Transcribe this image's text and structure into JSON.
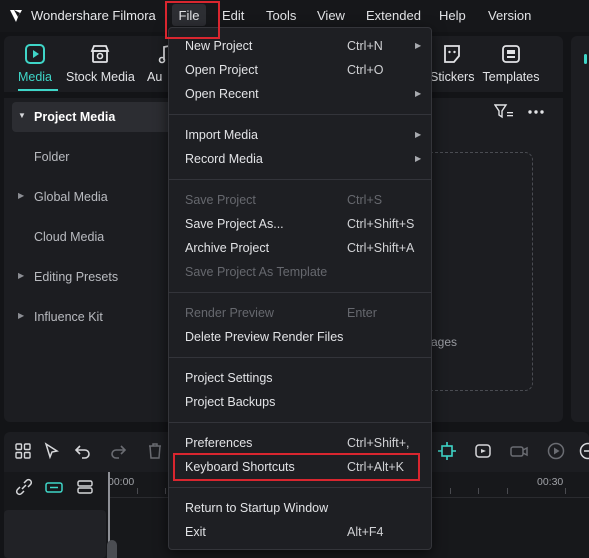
{
  "app": {
    "title": "Wondershare Filmora",
    "accent_color": "#3fd6c8",
    "highlight_color": "#d9262f"
  },
  "menubar": {
    "items": [
      "File",
      "Edit",
      "Tools",
      "View",
      "Extended",
      "Help",
      "Version"
    ],
    "active": "File"
  },
  "toolbar": {
    "tools": [
      {
        "label": "Media",
        "icon": "media-icon",
        "active": true
      },
      {
        "label": "Stock Media",
        "icon": "stock-media-icon"
      },
      {
        "label": "Au",
        "icon": "audio-icon"
      },
      {
        "label": "Stickers",
        "icon": "stickers-icon"
      },
      {
        "label": "Templates",
        "icon": "templates-icon"
      }
    ]
  },
  "sidebar": {
    "items": [
      {
        "label": "Project Media",
        "expandable": true,
        "active": true
      },
      {
        "label": "Folder",
        "expandable": false
      },
      {
        "label": "Global Media",
        "expandable": true
      },
      {
        "label": "Cloud Media",
        "expandable": false
      },
      {
        "label": "Editing Presets",
        "expandable": true
      },
      {
        "label": "Influence Kit",
        "expandable": true
      }
    ]
  },
  "media_area": {
    "dropzone_text": "ages"
  },
  "timeline": {
    "time_start": "00:00",
    "time_end": "00:30"
  },
  "file_menu": {
    "groups": [
      [
        {
          "label": "New Project",
          "shortcut": "Ctrl+N",
          "submenu": true
        },
        {
          "label": "Open Project",
          "shortcut": "Ctrl+O"
        },
        {
          "label": "Open Recent",
          "shortcut": "",
          "submenu": true
        }
      ],
      [
        {
          "label": "Import Media",
          "shortcut": "",
          "submenu": true
        },
        {
          "label": "Record Media",
          "shortcut": "",
          "submenu": true
        }
      ],
      [
        {
          "label": "Save Project",
          "shortcut": "Ctrl+S",
          "disabled": true
        },
        {
          "label": "Save Project As...",
          "shortcut": "Ctrl+Shift+S"
        },
        {
          "label": "Archive Project",
          "shortcut": "Ctrl+Shift+A"
        },
        {
          "label": "Save Project As Template",
          "shortcut": "",
          "disabled": true
        }
      ],
      [
        {
          "label": "Render Preview",
          "shortcut": "Enter",
          "disabled": true
        },
        {
          "label": "Delete Preview Render Files",
          "shortcut": ""
        }
      ],
      [
        {
          "label": "Project Settings",
          "shortcut": ""
        },
        {
          "label": "Project Backups",
          "shortcut": ""
        }
      ],
      [
        {
          "label": "Preferences",
          "shortcut": "Ctrl+Shift+,"
        },
        {
          "label": "Keyboard Shortcuts",
          "shortcut": "Ctrl+Alt+K",
          "highlighted": true
        }
      ],
      [
        {
          "label": "Return to Startup Window",
          "shortcut": ""
        },
        {
          "label": "Exit",
          "shortcut": "Alt+F4"
        }
      ]
    ]
  }
}
